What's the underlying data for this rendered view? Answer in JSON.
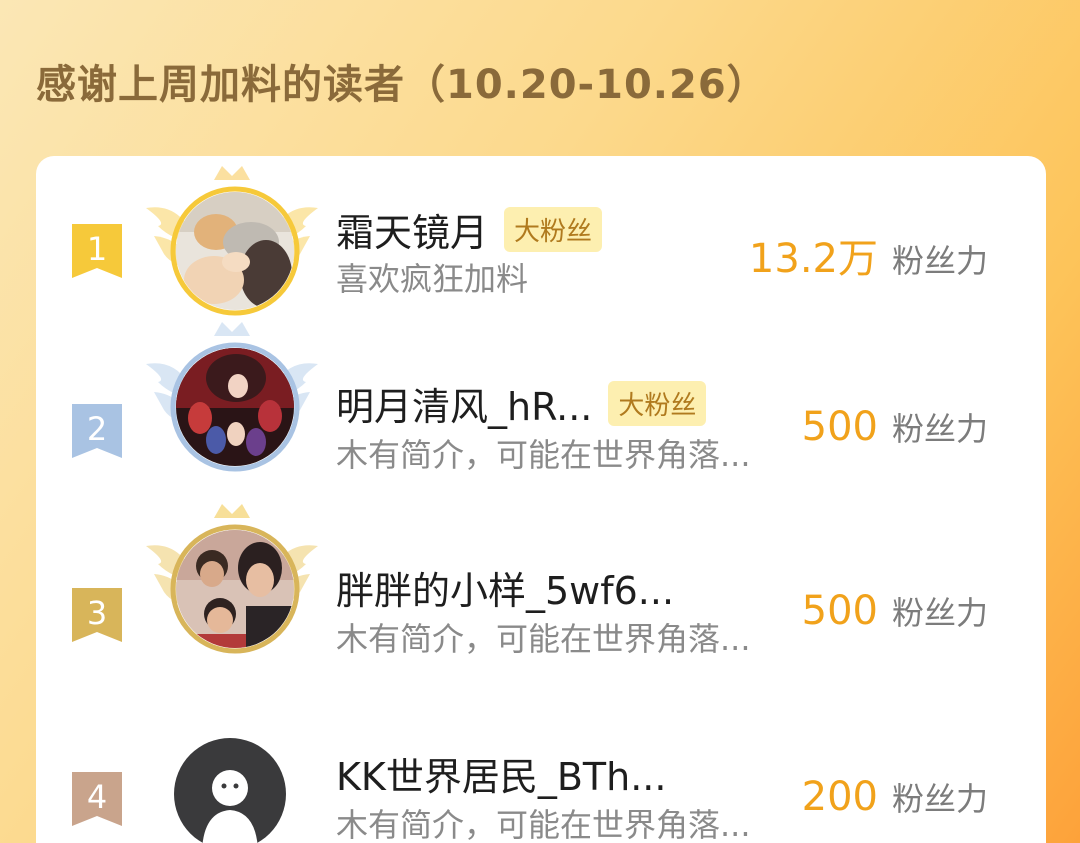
{
  "header": {
    "title": "感谢上周加料的读者（10.20-10.26）"
  },
  "ranking": [
    {
      "rank": "1",
      "name": "霜天镜月",
      "badge": "大粉丝",
      "description": "喜欢疯狂加料",
      "score": "13.2万",
      "score_unit": "粉丝力",
      "avatar_icon": "anime-figure-avatar"
    },
    {
      "rank": "2",
      "name": "明月清风_hR...",
      "badge": "大粉丝",
      "description": "木有简介，可能在世界角落...",
      "score": "500",
      "score_unit": "粉丝力",
      "avatar_icon": "anime-group-avatar"
    },
    {
      "rank": "3",
      "name": "胖胖的小样_5wf6...",
      "badge": "",
      "description": "木有简介，可能在世界角落...",
      "score": "500",
      "score_unit": "粉丝力",
      "avatar_icon": "family-photo-avatar"
    },
    {
      "rank": "4",
      "name": "KK世界居民_BTh...",
      "badge": "",
      "description": "木有简介，可能在世界角落...",
      "score": "200",
      "score_unit": "粉丝力",
      "avatar_icon": "default-user-avatar"
    }
  ],
  "colors": {
    "gold": "#f4c430",
    "silver": "#a9c3e3",
    "bronze": "#d8b55a",
    "fourth": "#c9a48c",
    "score": "#f1a21b",
    "badge_bg": "#fdefb0"
  }
}
